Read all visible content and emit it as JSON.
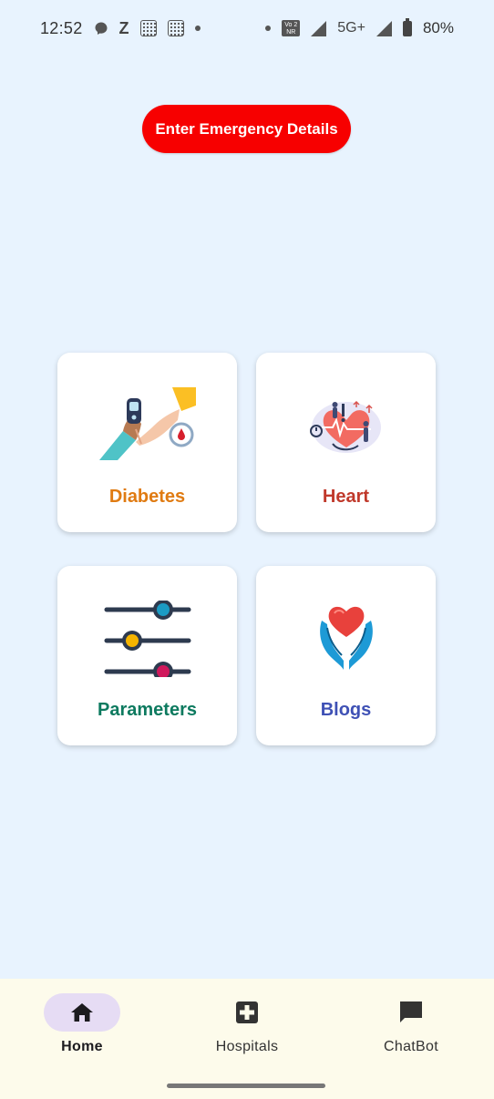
{
  "status_bar": {
    "time": "12:52",
    "network": "5G+",
    "battery": "80%",
    "icons": [
      "messenger-icon",
      "z-icon",
      "grid-app-icon",
      "grid-app-icon",
      "dot",
      "dot",
      "volte-icon",
      "signal-icon",
      "signal-icon",
      "battery-icon"
    ]
  },
  "emergency": {
    "label": "Enter Emergency Details",
    "color": "#f70000"
  },
  "cards": [
    {
      "label": "Diabetes",
      "icon": "glucose-meter-icon",
      "color": "#e07b12"
    },
    {
      "label": "Heart",
      "icon": "heart-checkup-icon",
      "color": "#c0392b"
    },
    {
      "label": "Parameters",
      "icon": "sliders-icon",
      "color": "#0d7a5f"
    },
    {
      "label": "Blogs",
      "icon": "heart-in-hands-icon",
      "color": "#3f51b5"
    }
  ],
  "bottom_nav": {
    "items": [
      {
        "label": "Home",
        "icon": "home-icon",
        "active": true
      },
      {
        "label": "Hospitals",
        "icon": "hospital-cross-icon",
        "active": false
      },
      {
        "label": "ChatBot",
        "icon": "chat-bubble-icon",
        "active": false
      }
    ]
  },
  "colors": {
    "background": "#e8f3fe",
    "nav_background": "#fdfbeb",
    "active_pill": "#e6dcf4"
  }
}
